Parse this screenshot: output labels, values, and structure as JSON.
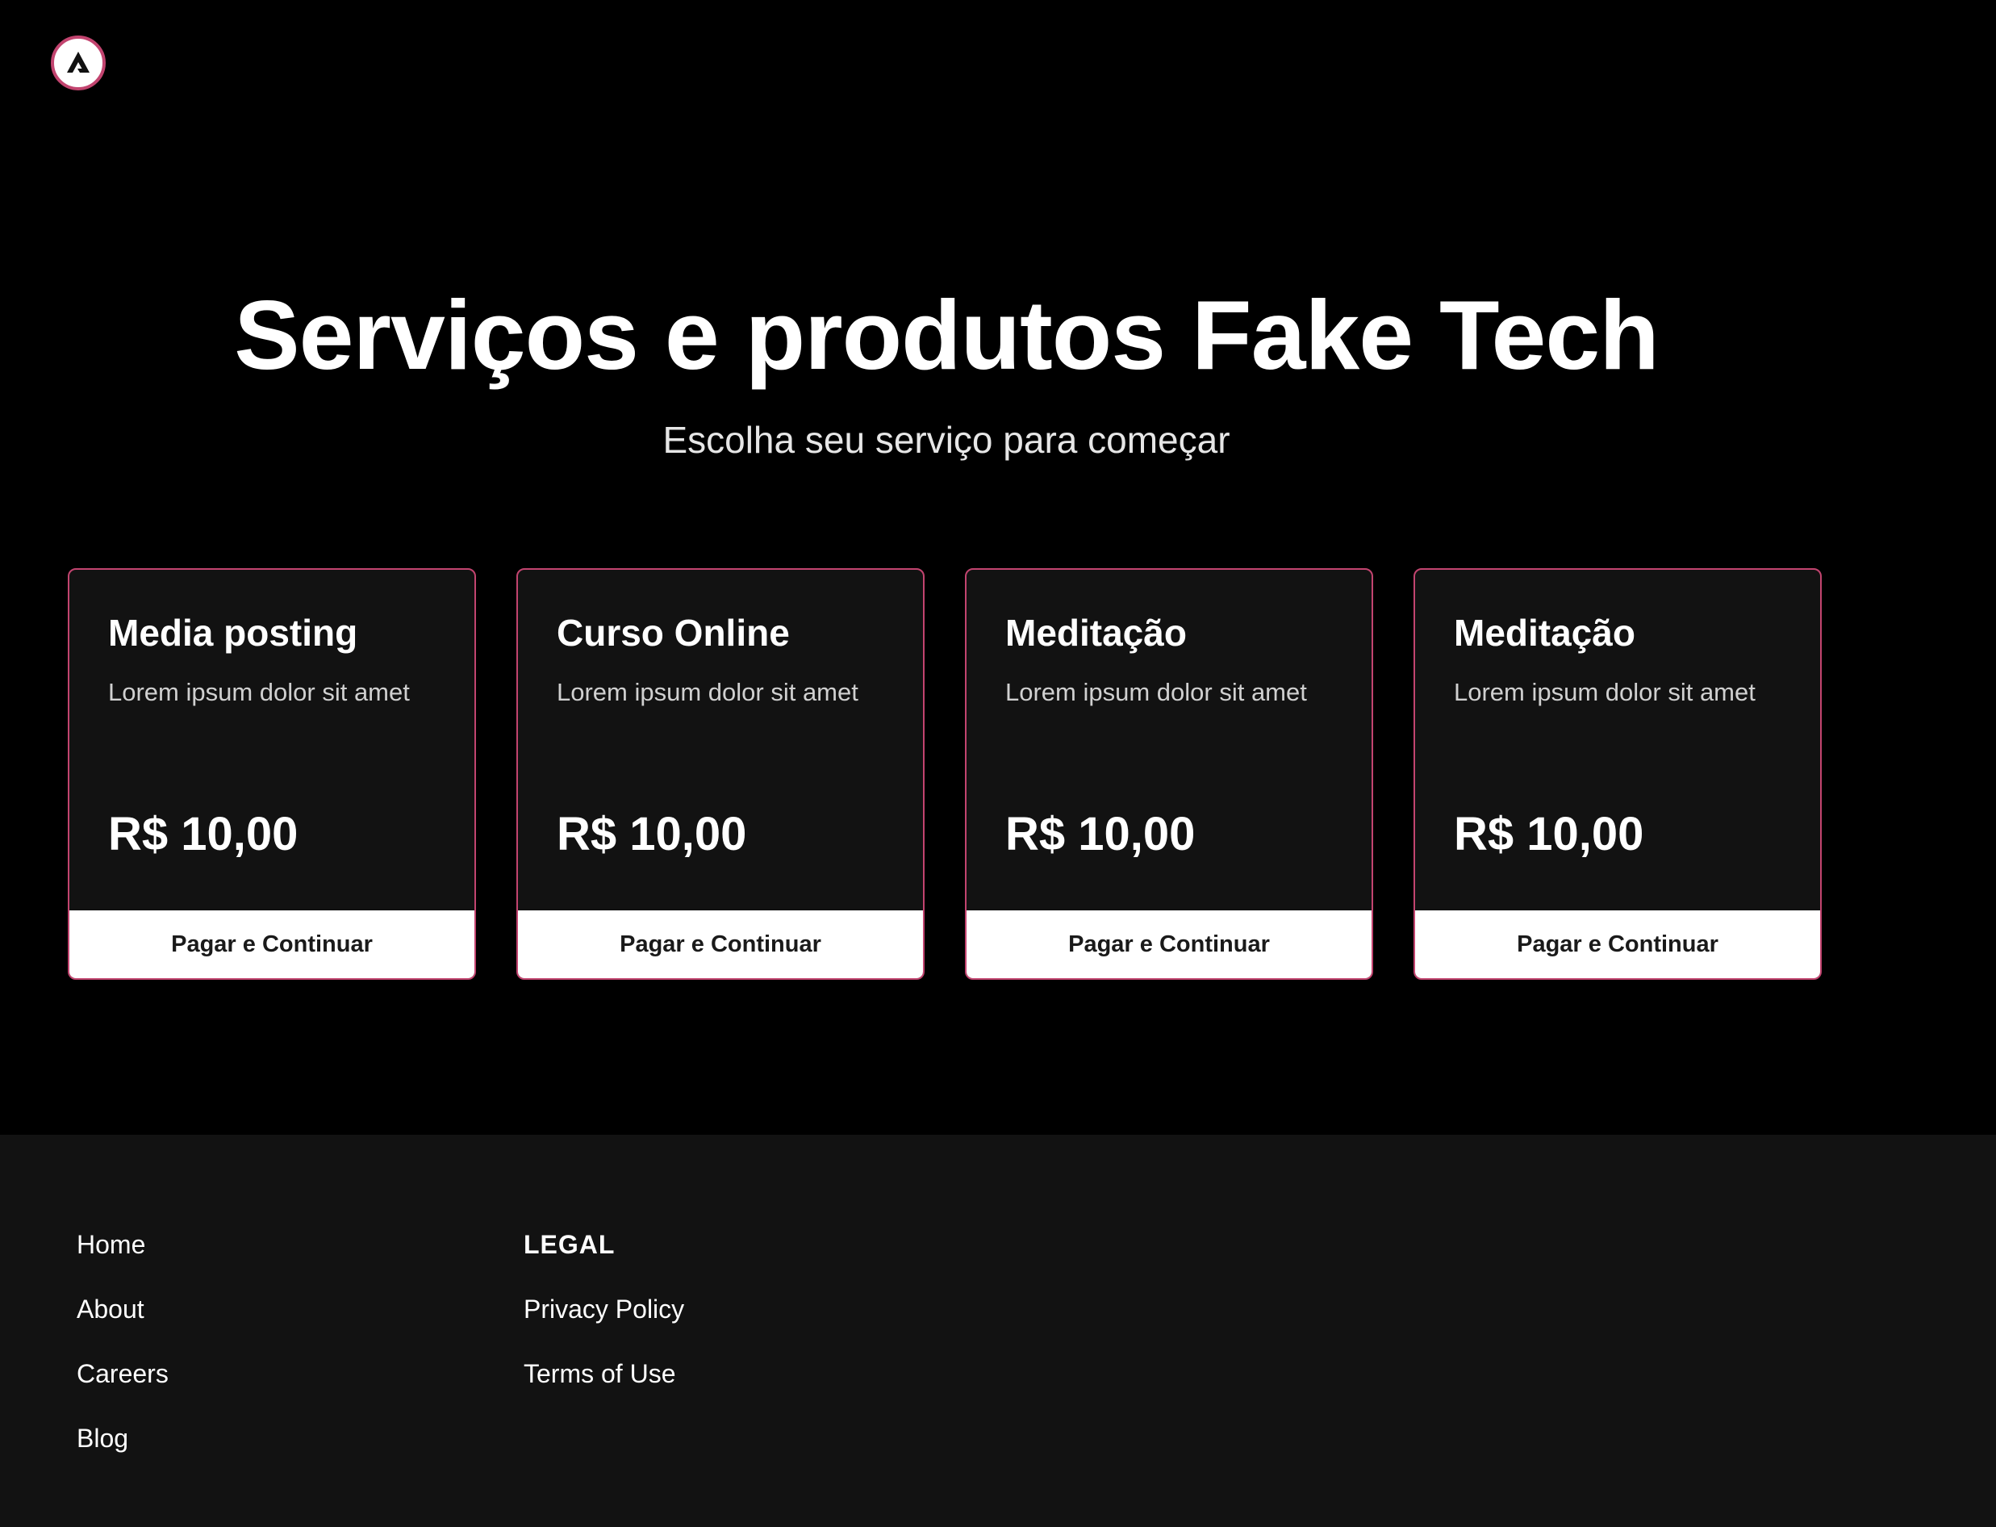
{
  "header": {
    "logo_icon": "triangle-a-logo-icon",
    "logo_border_color": "#c2446f"
  },
  "hero": {
    "title": "Serviços e produtos Fake Tech",
    "subtitle": "Escolha seu serviço para começar"
  },
  "cards": [
    {
      "title": "Media posting",
      "description": "Lorem ipsum dolor sit amet",
      "price": "R$ 10,00",
      "button_label": "Pagar e Continuar"
    },
    {
      "title": "Curso Online",
      "description": "Lorem ipsum dolor sit amet",
      "price": "R$ 10,00",
      "button_label": "Pagar e Continuar"
    },
    {
      "title": "Meditação",
      "description": "Lorem ipsum dolor sit amet",
      "price": "R$ 10,00",
      "button_label": "Pagar e Continuar"
    },
    {
      "title": "Meditação",
      "description": "Lorem ipsum dolor sit amet",
      "price": "R$ 10,00",
      "button_label": "Pagar e Continuar"
    }
  ],
  "footer": {
    "nav_links": [
      "Home",
      "About",
      "Careers",
      "Blog"
    ],
    "legal_heading": "LEGAL",
    "legal_links": [
      "Privacy Policy",
      "Terms of Use"
    ]
  },
  "colors": {
    "background": "#000000",
    "card_background": "#121212",
    "accent": "#c2446f",
    "footer_background": "#121212",
    "button_background": "#ffffff"
  }
}
